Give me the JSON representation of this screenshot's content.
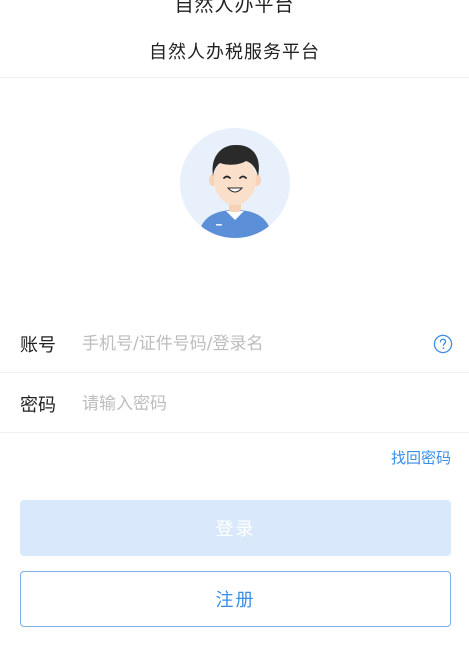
{
  "status_bar": {
    "cut_title": "自然人办平台"
  },
  "nav": {
    "title": "自然人办税服务平台"
  },
  "colors": {
    "accent": "#3a8ee6",
    "login_button_disabled": "#d9e9fb",
    "avatar_bg": "#e8f0fb",
    "shirt": "#5b8fd8"
  },
  "avatar": {
    "icon": "user-avatar-icon"
  },
  "form": {
    "account": {
      "label": "账号",
      "value": "",
      "placeholder": "手机号/证件号码/登录名",
      "help_icon": "question-circle-icon"
    },
    "password": {
      "label": "密码",
      "value": "",
      "placeholder": "请输入密码"
    },
    "forgot_password": "找回密码"
  },
  "buttons": {
    "login": "登录",
    "register": "注册"
  }
}
